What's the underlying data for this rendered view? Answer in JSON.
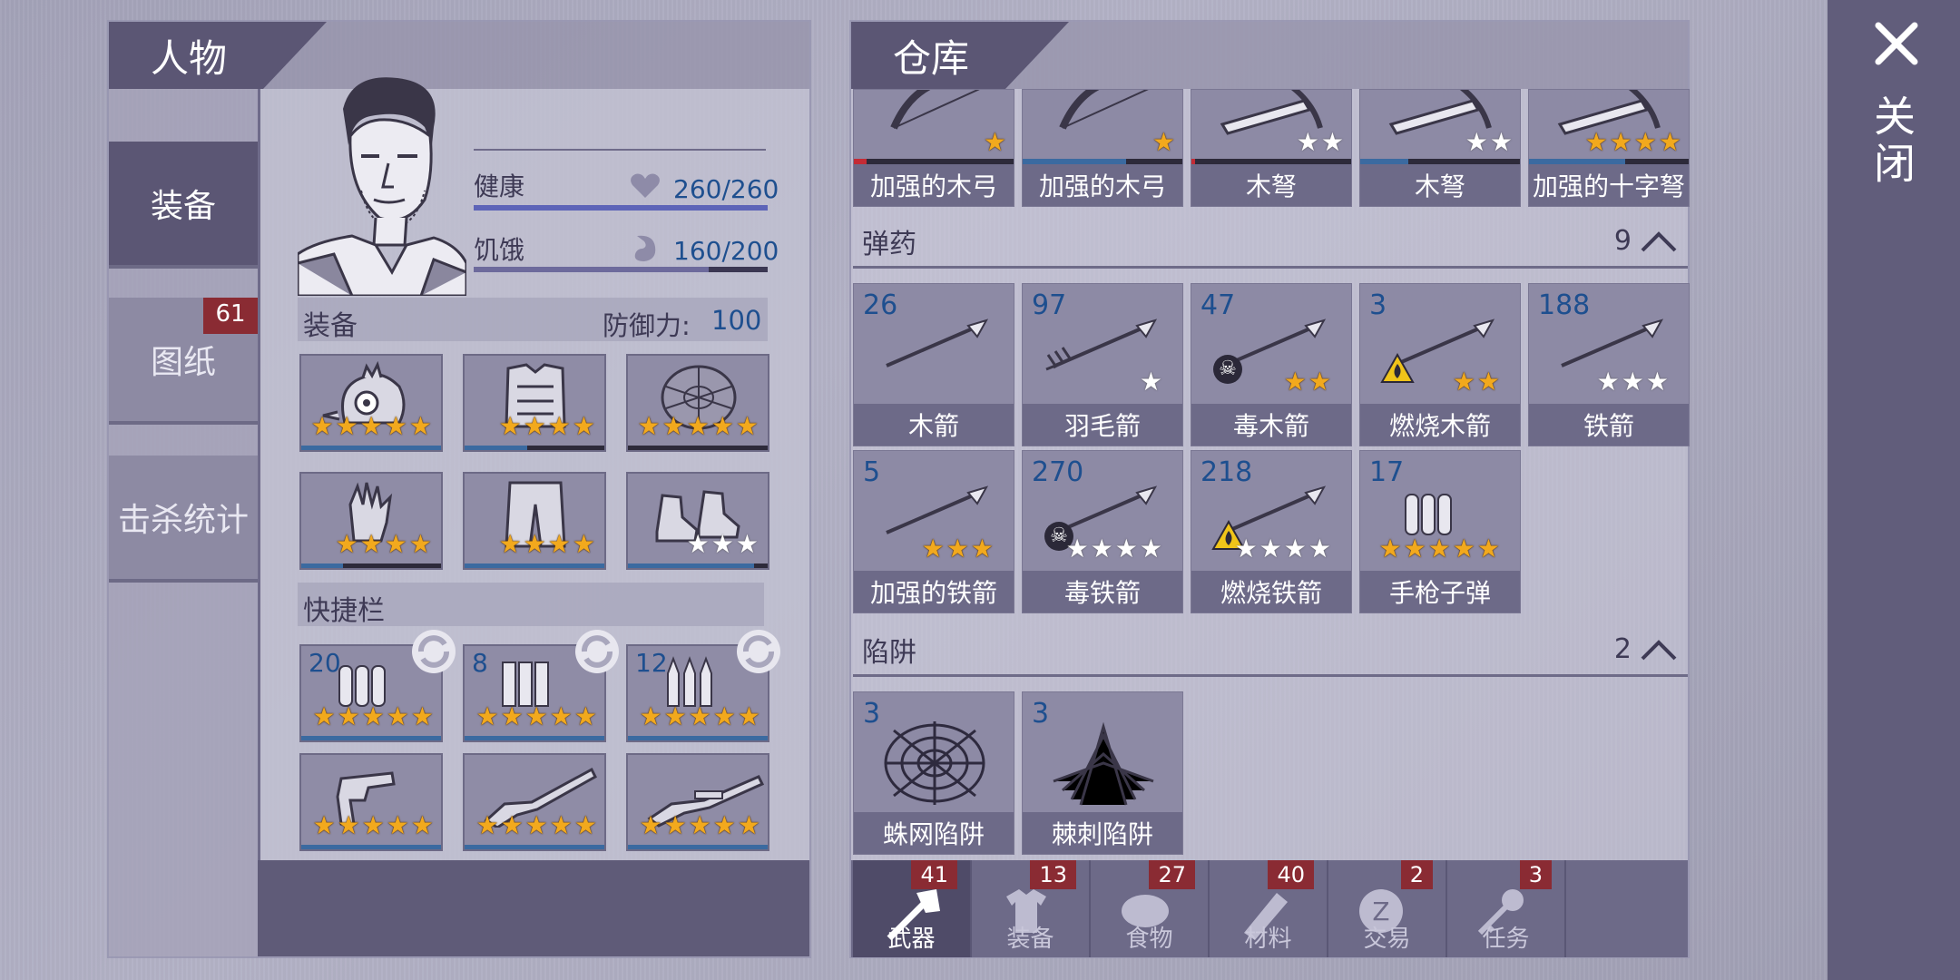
{
  "left": {
    "title": "人物",
    "side_tabs": [
      {
        "label": "装备",
        "active": true
      },
      {
        "label": "图纸",
        "badge": "61"
      },
      {
        "label": "击杀统计"
      }
    ],
    "stats": {
      "health_label": "健康",
      "health_value": "260/260",
      "health_fraction": 1.0,
      "hunger_label": "饥饿",
      "hunger_value": "160/200",
      "hunger_fraction": 0.8
    },
    "equipment": {
      "label": "装备",
      "defense_label": "防御力:",
      "defense_value": "100"
    },
    "gear": [
      {
        "icon": "chicken-helmet-icon",
        "stars": 5,
        "star_type": "gold",
        "durability": 1.0
      },
      {
        "icon": "armor-vest-icon",
        "stars": 4,
        "star_type": "gold",
        "durability": 0.45
      },
      {
        "icon": "turtle-shell-icon",
        "stars": 5,
        "star_type": "gold",
        "durability": 0.0
      },
      {
        "icon": "gloves-icon",
        "stars": 4,
        "star_type": "gold",
        "durability": 0.3
      },
      {
        "icon": "pants-icon",
        "stars": 4,
        "star_type": "gold",
        "durability": 1.0
      },
      {
        "icon": "sneakers-icon",
        "stars": 3,
        "star_type": "white",
        "durability": 0.9
      }
    ],
    "quickbar": {
      "label": "快捷栏",
      "slots": [
        {
          "count": "20",
          "icon": "pistol-ammo-icon",
          "stars": 5
        },
        {
          "count": "8",
          "icon": "shotgun-shells-icon",
          "stars": 5
        },
        {
          "count": "12",
          "icon": "rifle-bullets-icon",
          "stars": 5
        },
        {
          "count": "",
          "icon": "revolver-icon",
          "stars": 5
        },
        {
          "count": "",
          "icon": "shotgun-icon",
          "stars": 5
        },
        {
          "count": "",
          "icon": "rifle-icon",
          "stars": 5
        }
      ]
    }
  },
  "right": {
    "title": "仓库",
    "weapons_row": [
      {
        "label": "加强的木弓",
        "stars": 1,
        "star_type": "gold",
        "durability": 0.08,
        "bar_color": "#c42b35"
      },
      {
        "label": "加强的木弓",
        "stars": 1,
        "star_type": "gold",
        "durability": 0.65,
        "bar_color": "#3b6aa0"
      },
      {
        "label": "木弩",
        "stars": 2,
        "star_type": "white",
        "durability": 0.02,
        "bar_color": "#c42b35"
      },
      {
        "label": "木弩",
        "stars": 2,
        "star_type": "white",
        "durability": 0.3,
        "bar_color": "#3b6aa0"
      },
      {
        "label": "加强的十字弩",
        "stars": 4,
        "star_type": "gold",
        "durability": 0.6,
        "bar_color": "#3b6aa0"
      }
    ],
    "ammo": {
      "title": "弹药",
      "count": "9",
      "items": [
        {
          "count": "26",
          "label": "木箭",
          "stars": 0,
          "star_type": "gold",
          "badge": ""
        },
        {
          "count": "97",
          "label": "羽毛箭",
          "stars": 1,
          "star_type": "white",
          "badge": ""
        },
        {
          "count": "47",
          "label": "毒木箭",
          "stars": 2,
          "star_type": "gold",
          "badge": "poison"
        },
        {
          "count": "3",
          "label": "燃烧木箭",
          "stars": 2,
          "star_type": "gold",
          "badge": "fire"
        },
        {
          "count": "188",
          "label": "铁箭",
          "stars": 3,
          "star_type": "white",
          "badge": ""
        },
        {
          "count": "5",
          "label": "加强的铁箭",
          "stars": 3,
          "star_type": "gold",
          "badge": ""
        },
        {
          "count": "270",
          "label": "毒铁箭",
          "stars": 4,
          "star_type": "white",
          "badge": "poison"
        },
        {
          "count": "218",
          "label": "燃烧铁箭",
          "stars": 4,
          "star_type": "white",
          "badge": "fire"
        },
        {
          "count": "17",
          "label": "手枪子弹",
          "stars": 5,
          "star_type": "gold",
          "badge": ""
        }
      ]
    },
    "traps": {
      "title": "陷阱",
      "count": "2",
      "items": [
        {
          "count": "3",
          "label": "蛛网陷阱"
        },
        {
          "count": "3",
          "label": "棘刺陷阱"
        }
      ]
    },
    "bottom_tabs": [
      {
        "label": "武器",
        "badge": "41",
        "icon": "axe-icon",
        "active": true
      },
      {
        "label": "装备",
        "badge": "13",
        "icon": "shirt-icon"
      },
      {
        "label": "食物",
        "badge": "27",
        "icon": "meat-icon"
      },
      {
        "label": "材料",
        "badge": "40",
        "icon": "wood-log-icon"
      },
      {
        "label": "交易",
        "badge": "2",
        "icon": "coin-icon"
      },
      {
        "label": "任务",
        "badge": "3",
        "icon": "key-icon"
      }
    ]
  },
  "close": {
    "label": "关闭"
  },
  "colors": {
    "accent": "#5b5674",
    "value_blue": "#1e4f8f",
    "badge_red": "#8a2b33",
    "star_gold": "#f2a91d"
  }
}
